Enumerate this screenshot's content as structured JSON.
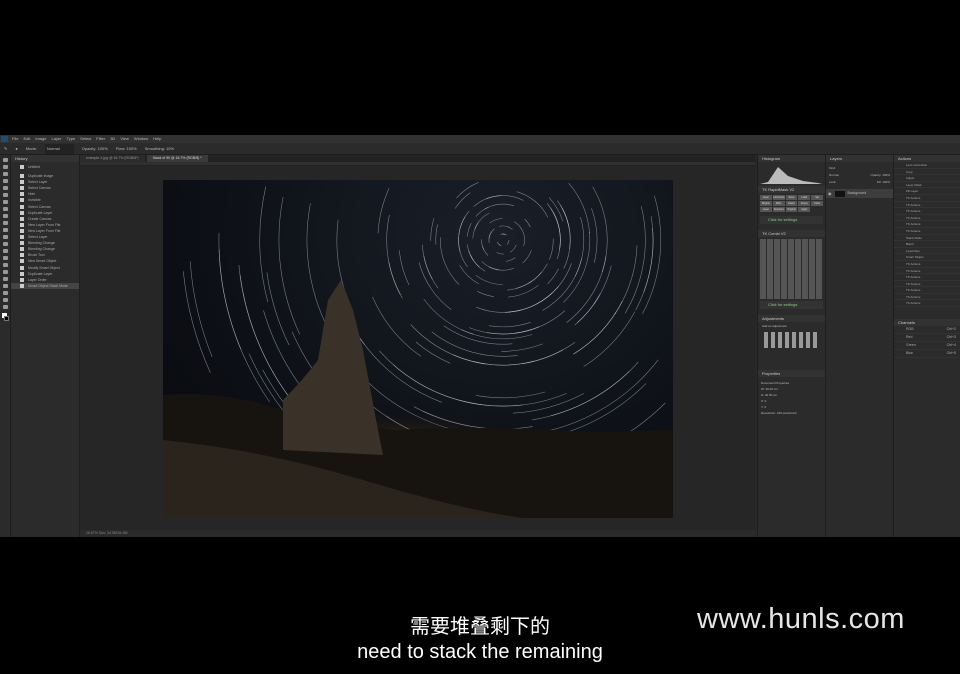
{
  "menu": [
    "File",
    "Edit",
    "Image",
    "Layer",
    "Type",
    "Select",
    "Filter",
    "3D",
    "View",
    "Window",
    "Help"
  ],
  "options": {
    "mode_label": "Mode:",
    "mode": "Normal",
    "opacity": "Opacity: 100%",
    "flow": "Flow: 100%",
    "smoothing": "Smoothing: 10%"
  },
  "tabs": [
    "example-1.jpg @ 16.7% (RGB/8*)",
    "Stack of 90 @ 16.7% (RGB/8) *"
  ],
  "history": {
    "title": "History",
    "snapshot": "Untitled",
    "items": [
      "Duplicate Image",
      "Select Layer",
      "Select Canvas",
      "Hide",
      "Invisible",
      "Select Canvas",
      "Duplicate Layer",
      "Create Canvas",
      "New Layer From File",
      "New Layer From File",
      "Select Layer",
      "Blending Change",
      "Blending Change",
      "Brush Tool",
      "New Smart Object",
      "Modify Smart Object",
      "Duplicate Layer",
      "Layer Order",
      "Smart Object Stack Mode"
    ]
  },
  "status": "16.67%   Doc: 34.3M/34.3M",
  "histogram": {
    "title": "Histogram"
  },
  "plugins": {
    "panel1": "TK RapidMask V2",
    "panel2": "TK Combi V2",
    "click_settings": "Click for settings",
    "buttons": [
      "Layer Mask",
      "Luminosity",
      "Save",
      "Load",
      "Set",
      "Brights",
      "Mids",
      "Darks",
      "Zones",
      "Color",
      "Layer",
      "Selected",
      "Original",
      "Apply"
    ]
  },
  "adjustments": {
    "title": "Adjustments",
    "subtitle": "Add an adjustment"
  },
  "properties": {
    "title": "Properties",
    "label": "Document Properties",
    "w": "W: 30.00 cm",
    "h": "H: 20.00 cm",
    "x": "X: 0",
    "y": "Y: 0",
    "res": "Resolution: 240 pixels/inch"
  },
  "layers": {
    "title": "Layers",
    "kind": "Kind",
    "blend": "Normal",
    "opacity": "Opacity: 100%",
    "lock": "Lock:",
    "fill": "Fill: 100%",
    "items": [
      "Background"
    ]
  },
  "actions": {
    "title": "Actions",
    "items": [
      "Lens Correction",
      "Crop",
      "Adjust",
      "Layer Mask",
      "Fill Layer",
      "TK Actions",
      "TK Actions",
      "TK Actions",
      "TK Actions",
      "TK Actions",
      "TK Actions",
      "Stack Mode",
      "Batch",
      "Load Files",
      "Smart Object",
      "TK Actions",
      "TK Actions",
      "TK Actions",
      "TK Actions",
      "TK Actions",
      "TK Actions",
      "TK Actions"
    ]
  },
  "channels": {
    "title": "Channels",
    "items": [
      {
        "name": "RGB",
        "key": "Ctrl+2"
      },
      {
        "name": "Red",
        "key": "Ctrl+3"
      },
      {
        "name": "Green",
        "key": "Ctrl+4"
      },
      {
        "name": "Blue",
        "key": "Ctrl+5"
      }
    ]
  },
  "subtitle": {
    "zh": "需要堆叠剩下的",
    "en": "need to stack the remaining"
  },
  "watermark": "www.hunls.com"
}
